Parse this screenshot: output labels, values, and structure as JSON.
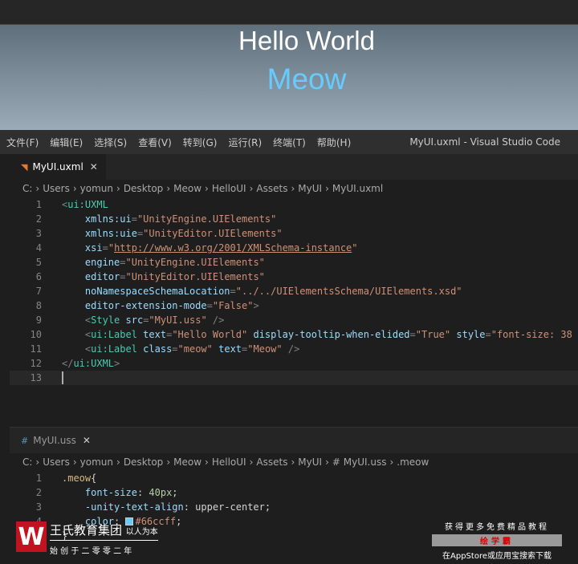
{
  "preview": {
    "hello": "Hello World",
    "meow": "Meow"
  },
  "menu": [
    "文件(F)",
    "编辑(E)",
    "选择(S)",
    "查看(V)",
    "转到(G)",
    "运行(R)",
    "终端(T)",
    "帮助(H)"
  ],
  "window_title": "MyUI.uxml - Visual Studio Code",
  "editor1": {
    "tab": "MyUI.uxml",
    "tab_icon": "rss-xml-icon",
    "close": "✕",
    "breadcrumb": [
      "C:",
      "Users",
      "yomun",
      "Desktop",
      "Meow",
      "HelloUI",
      "Assets",
      "MyUI",
      "MyUI.uxml"
    ],
    "lines": [
      [
        [
          "pun",
          "<"
        ],
        [
          "tag",
          "ui:UXML"
        ]
      ],
      [
        [
          "txt",
          "    "
        ],
        [
          "att",
          "xmlns:ui"
        ],
        [
          "pun",
          "="
        ],
        [
          "str",
          "\"UnityEngine.UIElements\""
        ]
      ],
      [
        [
          "txt",
          "    "
        ],
        [
          "att",
          "xmlns:uie"
        ],
        [
          "pun",
          "="
        ],
        [
          "str",
          "\"UnityEditor.UIElements\""
        ]
      ],
      [
        [
          "txt",
          "    "
        ],
        [
          "att",
          "xsi"
        ],
        [
          "pun",
          "="
        ],
        [
          "str",
          "\""
        ],
        [
          "url",
          "http://www.w3.org/2001/XMLSchema-instance"
        ],
        [
          "str",
          "\""
        ]
      ],
      [
        [
          "txt",
          "    "
        ],
        [
          "att",
          "engine"
        ],
        [
          "pun",
          "="
        ],
        [
          "str",
          "\"UnityEngine.UIElements\""
        ]
      ],
      [
        [
          "txt",
          "    "
        ],
        [
          "att",
          "editor"
        ],
        [
          "pun",
          "="
        ],
        [
          "str",
          "\"UnityEditor.UIElements\""
        ]
      ],
      [
        [
          "txt",
          "    "
        ],
        [
          "att",
          "noNamespaceSchemaLocation"
        ],
        [
          "pun",
          "="
        ],
        [
          "str",
          "\"../../UIElementsSchema/UIElements.xsd\""
        ]
      ],
      [
        [
          "txt",
          "    "
        ],
        [
          "att",
          "editor-extension-mode"
        ],
        [
          "pun",
          "="
        ],
        [
          "str",
          "\"False\""
        ],
        [
          "pun",
          ">"
        ]
      ],
      [
        [
          "txt",
          "    "
        ],
        [
          "pun",
          "<"
        ],
        [
          "tag",
          "Style"
        ],
        [
          "txt",
          " "
        ],
        [
          "att",
          "src"
        ],
        [
          "pun",
          "="
        ],
        [
          "str",
          "\"MyUI.uss\""
        ],
        [
          "pun",
          " />"
        ]
      ],
      [
        [
          "txt",
          "    "
        ],
        [
          "pun",
          "<"
        ],
        [
          "tag",
          "ui:Label"
        ],
        [
          "txt",
          " "
        ],
        [
          "att",
          "text"
        ],
        [
          "pun",
          "="
        ],
        [
          "str",
          "\"Hello World\""
        ],
        [
          "txt",
          " "
        ],
        [
          "att",
          "display-tooltip-when-elided"
        ],
        [
          "pun",
          "="
        ],
        [
          "str",
          "\"True\""
        ],
        [
          "txt",
          " "
        ],
        [
          "att",
          "style"
        ],
        [
          "pun",
          "="
        ],
        [
          "str",
          "\"font-size: 38"
        ]
      ],
      [
        [
          "txt",
          "    "
        ],
        [
          "pun",
          "<"
        ],
        [
          "tag",
          "ui:Label"
        ],
        [
          "txt",
          " "
        ],
        [
          "att",
          "class"
        ],
        [
          "pun",
          "="
        ],
        [
          "str",
          "\"meow\""
        ],
        [
          "txt",
          " "
        ],
        [
          "att",
          "text"
        ],
        [
          "pun",
          "="
        ],
        [
          "str",
          "\"Meow\""
        ],
        [
          "pun",
          " />"
        ]
      ],
      [
        [
          "pun",
          "</"
        ],
        [
          "tag",
          "ui:UXML"
        ],
        [
          "pun",
          ">"
        ]
      ],
      []
    ]
  },
  "editor2": {
    "tab": "MyUI.uss",
    "tab_icon": "#",
    "close": "✕",
    "breadcrumb": [
      "C:",
      "Users",
      "yomun",
      "Desktop",
      "Meow",
      "HelloUI",
      "Assets",
      "MyUI",
      "# MyUI.uss",
      ".meow"
    ],
    "lines": [
      [
        [
          "sel",
          ".meow"
        ],
        [
          "txt",
          "{"
        ]
      ],
      [
        [
          "txt",
          "    "
        ],
        [
          "att",
          "font-size"
        ],
        [
          "txt",
          ": "
        ],
        [
          "num",
          "40px"
        ],
        [
          "txt",
          ";"
        ]
      ],
      [
        [
          "txt",
          "    "
        ],
        [
          "att",
          "-unity-text-align"
        ],
        [
          "txt",
          ": upper-center;"
        ]
      ],
      [
        [
          "txt",
          "    "
        ],
        [
          "att",
          "color"
        ],
        [
          "txt",
          ": "
        ],
        [
          "swatch",
          ""
        ],
        [
          "str",
          "#66ccff"
        ],
        [
          "txt",
          ";"
        ]
      ],
      [
        [
          "txt",
          "}"
        ]
      ]
    ]
  },
  "watermark": {
    "logo": "W",
    "org": "王氏教育集团",
    "motto": "以人为本",
    "since": "始 创 于 二 零 零 二 年",
    "promo": "获得更多免费精品教程",
    "app": "绘学霸",
    "download": "在AppStore或应用宝搜索下载"
  }
}
